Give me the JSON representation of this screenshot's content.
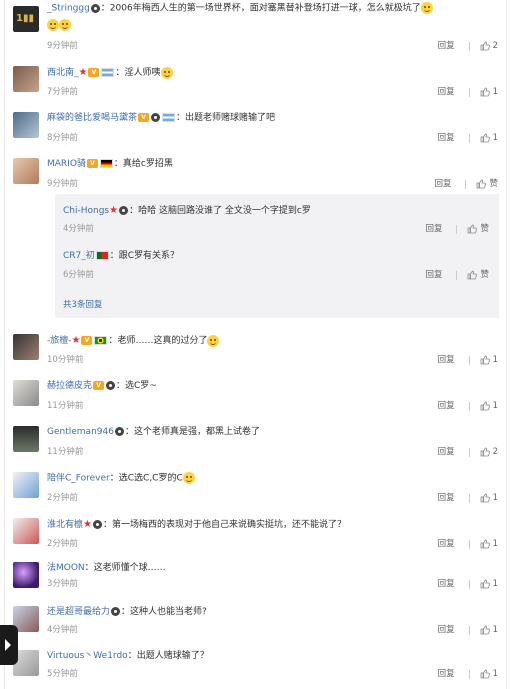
{
  "labels": {
    "reply": "回复",
    "zan": "赞"
  },
  "comments": [
    {
      "name": "_Stringgg",
      "text": "：2006年梅西人生的第一场世界杯，面对塞黑替补登场打进一球，怎么就极坑了",
      "time": "9分钟前",
      "likes": "2"
    },
    {
      "name": "西北南_",
      "text": "：淫人师咦",
      "time": "7分钟前",
      "likes": "1"
    },
    {
      "name": "麻袋的爸比爱喝马黛茶",
      "text": "：出题老师赌球赌输了吧",
      "time": "8分钟前",
      "likes": "1"
    },
    {
      "name": "MARIO骑",
      "text": "：真给c罗招黑",
      "time": "9分钟前",
      "likes": "赞"
    },
    {
      "name": "-旅檀-",
      "text": "：老师……这真的过分了",
      "time": "10分钟前",
      "likes": "1"
    },
    {
      "name": "赫拉德皮克",
      "text": "：选C罗~",
      "time": "11分钟前",
      "likes": "1"
    },
    {
      "name": "Gentleman946",
      "text": "：这个老师真是强，都黑上试卷了",
      "time": "11分钟前",
      "likes": "2"
    },
    {
      "name": "陪伴C_Forever",
      "text": "：选C选C,C罗的C",
      "time": "2分钟前",
      "likes": "1"
    },
    {
      "name": "淮北有檩",
      "text": "：第一场梅西的表现对于他自己来说确实挺坑，还不能说了？",
      "time": "2分钟前",
      "likes": "1"
    },
    {
      "name": "法MOON",
      "text": "：这老师懂个球……",
      "time": "3分钟前",
      "likes": "1"
    },
    {
      "name": "还是超哥最给力",
      "text": "：这种人也能当老师?",
      "time": "4分钟前",
      "likes": "1"
    },
    {
      "name": "Virtuous丶We1rdo",
      "text": "：出题人赌球输了？",
      "time": "5分钟前",
      "likes": "1"
    }
  ],
  "replies": [
    {
      "name": "Chi-Hongs",
      "text": "：哈哈 这脑回路没谁了 全文没一个字提到c罗",
      "time": "4分钟前",
      "likes": "赞"
    },
    {
      "name": "CR7_初",
      "text": "：跟C罗有关系？",
      "time": "6分钟前",
      "likes": "赞"
    }
  ],
  "more_replies": "共3条回复"
}
